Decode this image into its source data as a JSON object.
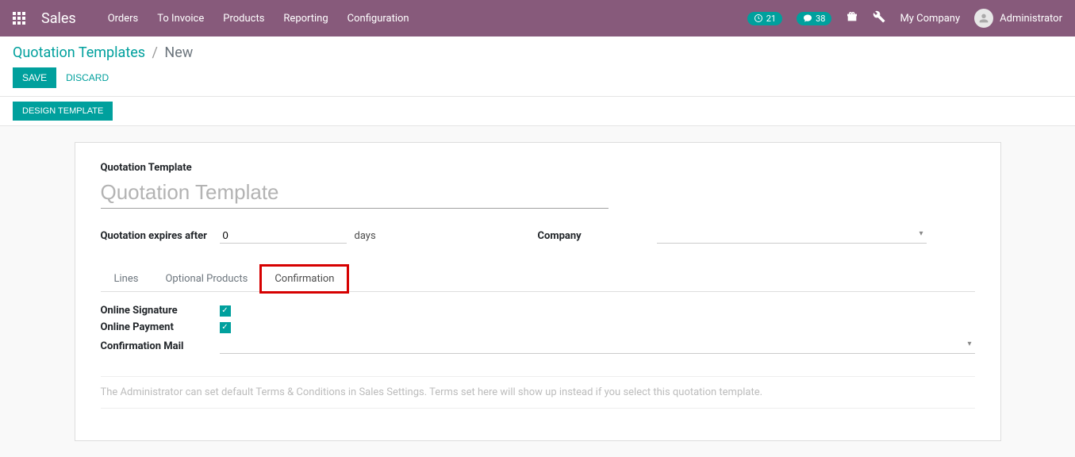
{
  "navbar": {
    "brand": "Sales",
    "links": [
      "Orders",
      "To Invoice",
      "Products",
      "Reporting",
      "Configuration"
    ],
    "activity_count": "21",
    "discuss_count": "38",
    "company": "My Company",
    "user": "Administrator"
  },
  "breadcrumb": {
    "parent": "Quotation Templates",
    "current": "New"
  },
  "buttons": {
    "save": "Save",
    "discard": "Discard",
    "design_template": "Design Template"
  },
  "form": {
    "title_label": "Quotation Template",
    "title_placeholder": "Quotation Template",
    "expires_label": "Quotation expires after",
    "expires_value": "0",
    "expires_suffix": "days",
    "company_label": "Company"
  },
  "tabs": {
    "lines": "Lines",
    "optional_products": "Optional Products",
    "confirmation": "Confirmation"
  },
  "confirmation": {
    "online_signature_label": "Online Signature",
    "online_payment_label": "Online Payment",
    "confirmation_mail_label": "Confirmation Mail"
  },
  "hint": "The Administrator can set default Terms & Conditions in Sales Settings. Terms set here will show up instead if you select this quotation template."
}
